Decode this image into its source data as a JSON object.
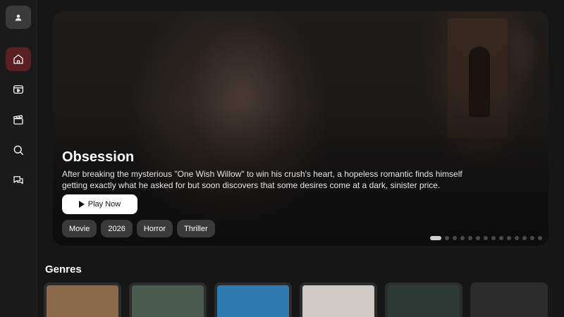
{
  "sidebar": {
    "avatar_icon": "user-icon",
    "items": [
      {
        "name": "home",
        "icon": "home-icon",
        "active": true
      },
      {
        "name": "tv",
        "icon": "tv-play-icon",
        "active": false
      },
      {
        "name": "movies",
        "icon": "clapperboard-icon",
        "active": false
      },
      {
        "name": "search",
        "icon": "search-icon",
        "active": false
      },
      {
        "name": "chat",
        "icon": "chat-icon",
        "active": false
      }
    ]
  },
  "hero": {
    "title": "Obsession",
    "description": "After breaking the mysterious \"One Wish Willow\" to win his crush's heart, a hopeless romantic finds himself getting exactly what he asked for but soon discovers that some desires come at a dark, sinister price.",
    "play_label": "Play Now",
    "tags": [
      "Movie",
      "2026",
      "Horror",
      "Thriller"
    ],
    "carousel": {
      "total": 14,
      "active_index": 0
    }
  },
  "genres": {
    "title": "Genres",
    "cards": [
      {
        "name": "genre-card-1",
        "thumb_color": "#8a6a4a"
      },
      {
        "name": "genre-card-2",
        "thumb_color": "#4a5a4e"
      },
      {
        "name": "genre-card-3",
        "thumb_color": "#2f7ab0"
      },
      {
        "name": "genre-card-4",
        "thumb_color": "#cfcac4"
      },
      {
        "name": "genre-card-5",
        "thumb_color": "#2e3a36"
      },
      {
        "name": "genre-card-6",
        "thumb_color": "#2c2c2c"
      }
    ]
  },
  "colors": {
    "accent_active_nav": "#5a1f22",
    "background": "#161616",
    "sidebar": "#1a1a1a",
    "tag_bg": "#3a3a3a"
  }
}
